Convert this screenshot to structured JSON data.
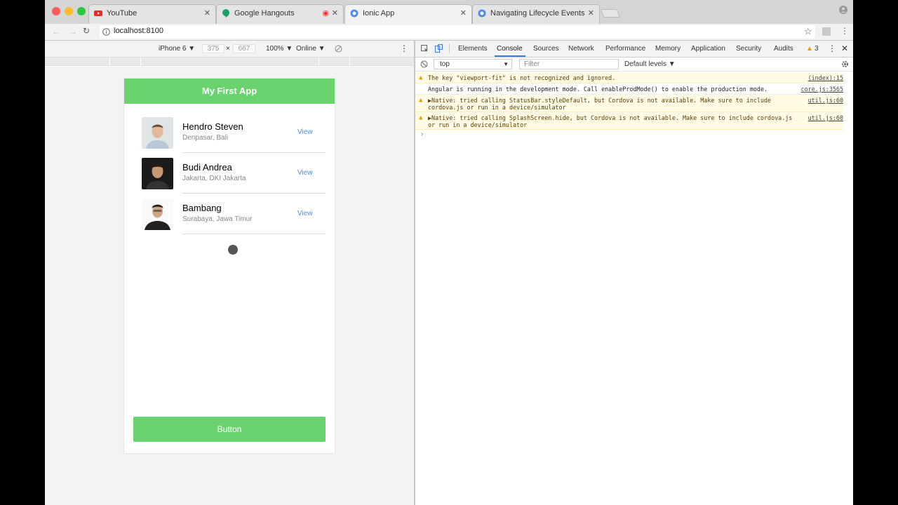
{
  "browser": {
    "tabs": [
      {
        "title": "YouTube",
        "icon": "youtube-icon"
      },
      {
        "title": "Google Hangouts",
        "icon": "hangouts-icon"
      },
      {
        "title": "Ionic App",
        "icon": "chrome-icon"
      },
      {
        "title": "Navigating Lifecycle Events! |",
        "icon": "chrome-icon"
      }
    ],
    "url": "localhost:8100"
  },
  "device_toolbar": {
    "device": "iPhone 6 ▼",
    "width": "375",
    "times": "×",
    "height": "667",
    "zoom": "100% ▼",
    "network": "Online ▼"
  },
  "app": {
    "title": "My First App",
    "items": [
      {
        "name": "Hendro Steven",
        "location": "Denpasar, Bali",
        "action": "View"
      },
      {
        "name": "Budi Andrea",
        "location": "Jakarta, DKI Jakarta",
        "action": "View"
      },
      {
        "name": "Bambang",
        "location": "Surabaya, Jawa Timur",
        "action": "View"
      }
    ],
    "button_label": "Button"
  },
  "devtools": {
    "tabs": [
      "Elements",
      "Console",
      "Sources",
      "Network",
      "Performance",
      "Memory",
      "Application",
      "Security",
      "Audits"
    ],
    "active_tab": "Console",
    "warning_count": "3",
    "context": "top",
    "filter_placeholder": "Filter",
    "levels": "Default levels ▼",
    "logs": [
      {
        "type": "warn",
        "message": "The key \"viewport-fit\" is not recognized and ignored.",
        "source": "(index):15"
      },
      {
        "type": "info",
        "message": "Angular is running in the development mode. Call enableProdMode() to enable the production mode.",
        "source": "core.js:3565"
      },
      {
        "type": "warn",
        "message": "▶Native: tried calling StatusBar.styleDefault, but Cordova is not available. Make sure to include cordova.js or run in a device/simulator",
        "source": "util.js:60"
      },
      {
        "type": "warn",
        "message": "▶Native: tried calling SplashScreen.hide, but Cordova is not available. Make sure to include cordova.js or run in a device/simulator",
        "source": "util.js:60"
      }
    ]
  },
  "colors": {
    "accent_green": "#6ad26f",
    "link_blue": "#4a8ee8",
    "active_tab_blue": "#3b7be8"
  }
}
